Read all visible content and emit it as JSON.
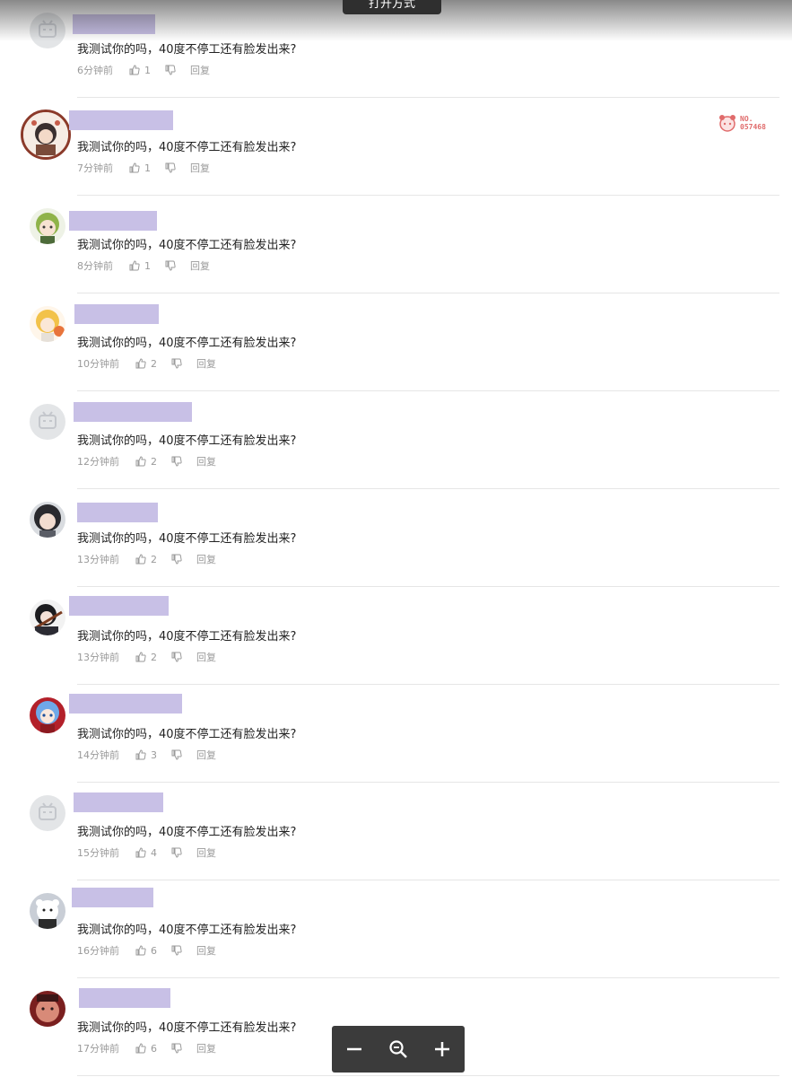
{
  "top_bar": {
    "label": "打开方式"
  },
  "comment_text": "我测试你的吗，40度不停工还有脸发出来?",
  "reply_label": "回复",
  "badge": {
    "line1": "NO.",
    "line2": "057468"
  },
  "comments": [
    {
      "time": "6分钟前",
      "likes": "1",
      "avatar": "default"
    },
    {
      "time": "7分钟前",
      "likes": "1",
      "avatar": "framed-girl"
    },
    {
      "time": "8分钟前",
      "likes": "1",
      "avatar": "green-hair"
    },
    {
      "time": "10分钟前",
      "likes": "2",
      "avatar": "blonde-girl"
    },
    {
      "time": "12分钟前",
      "likes": "2",
      "avatar": "default"
    },
    {
      "time": "13分钟前",
      "likes": "2",
      "avatar": "dark-hair-girl"
    },
    {
      "time": "13分钟前",
      "likes": "2",
      "avatar": "violinist"
    },
    {
      "time": "14分钟前",
      "likes": "3",
      "avatar": "blue-hair-red"
    },
    {
      "time": "15分钟前",
      "likes": "4",
      "avatar": "default"
    },
    {
      "time": "16分钟前",
      "likes": "6",
      "avatar": "snow-bear"
    },
    {
      "time": "17分钟前",
      "likes": "6",
      "avatar": "red-face"
    }
  ],
  "colors": {
    "redaction": "#c8c0e6",
    "meta_text": "#9a9a9a",
    "divider": "#e6e6e6",
    "zoom_bar": "#3b3b3b"
  },
  "zoom_controls": {
    "icons": [
      "minus-icon",
      "zoom-search-icon",
      "plus-icon"
    ]
  }
}
